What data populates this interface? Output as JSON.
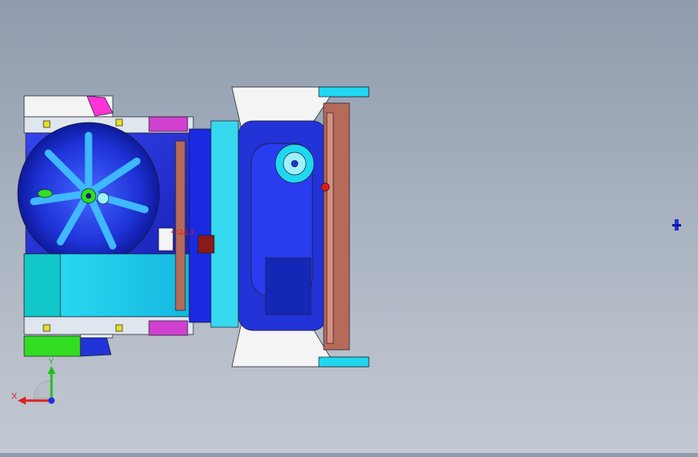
{
  "viewport": {
    "background_top": "#8f9cad",
    "background_bottom": "#c3c9d2"
  },
  "model": {
    "colors": {
      "blue": "#2233d8",
      "dark_blue": "#0d1a9c",
      "cyan": "#1fd8f0",
      "light_cyan": "#9ff0ff",
      "magenta": "#ff33d6",
      "green": "#33dd22",
      "brown": "#b56a5a",
      "dark_red": "#8a1a1a",
      "white": "#f4f4f4",
      "yellow": "#e8e020",
      "line": "#1a1a2a"
    },
    "annotation_text": "<=2&.3"
  },
  "triad": {
    "x_label": "X",
    "y_label": "Y",
    "x_color": "#e02020",
    "y_color": "#20c020",
    "z_color": "#2030e0"
  },
  "icons": {
    "view_triad": "coordinate-triad-icon",
    "marker": "point-marker-icon"
  }
}
